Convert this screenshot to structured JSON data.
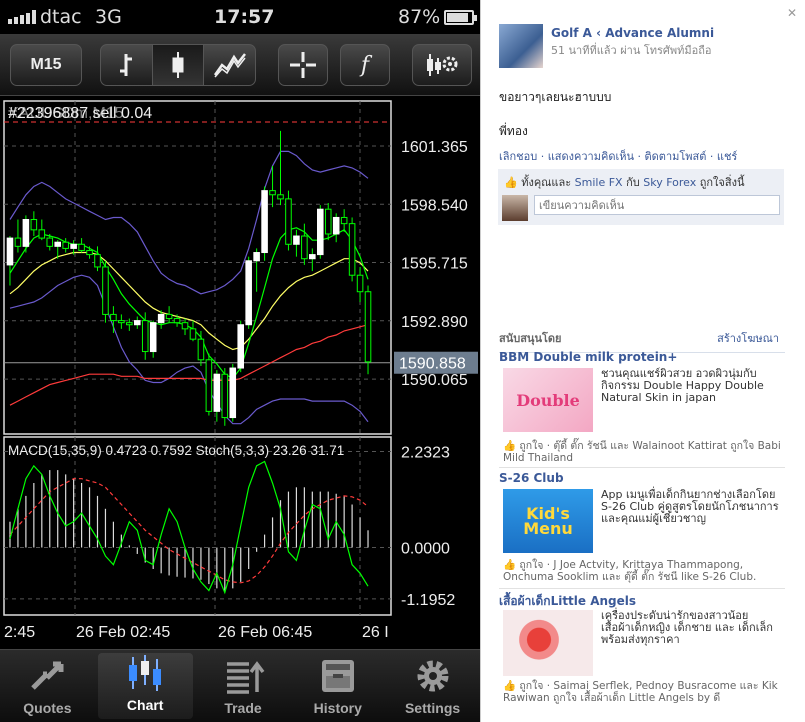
{
  "status_bar": {
    "carrier": "dtac",
    "network": "3G",
    "time": "17:57",
    "battery": "87%",
    "battery_level": 0.87
  },
  "toolbar": {
    "timeframe": "M15",
    "indicator_symbol": "f"
  },
  "chart": {
    "symbol_overlay": "#22396887 sell 0.04",
    "symbol_overlay_2": "XAUUSDm,M15",
    "price_ticks": [
      "1601.365",
      "1598.540",
      "1595.715",
      "1592.890",
      "1590.065"
    ],
    "current_price": "1590.858",
    "indicator_label": "MACD(15,35,9) 0.4723 0.7592 Stoch(5,3,3) 23.26 31.71",
    "indicator_ticks": [
      "2.2323",
      "0.0000",
      "-1.1952"
    ],
    "time_labels": [
      "2:45",
      "26 Feb 02:45",
      "26 Feb 06:45",
      "26 I"
    ],
    "colors": {
      "up": "#ffffff",
      "down": "#00ff00",
      "wick": "#00ff00",
      "ma_fast": "#00ff00",
      "ma_slow": "#ff3b3b",
      "ma_mid": "#ffff66",
      "bands": "#6a5acd",
      "grid": "#555555"
    }
  },
  "chart_data": {
    "type": "candlestick",
    "ylim": [
      1587.5,
      1603.4
    ],
    "y_ticks": [
      1601.365,
      1598.54,
      1595.715,
      1592.89,
      1590.065
    ],
    "current_price": 1590.858,
    "candles": [
      [
        1595.6,
        1597.0,
        1594.6,
        1596.9
      ],
      [
        1596.9,
        1597.8,
        1596.2,
        1596.5
      ],
      [
        1596.5,
        1598.0,
        1596.2,
        1597.8
      ],
      [
        1597.8,
        1598.2,
        1597.0,
        1597.3
      ],
      [
        1597.3,
        1597.8,
        1596.8,
        1596.9
      ],
      [
        1596.9,
        1597.1,
        1596.3,
        1596.5
      ],
      [
        1596.5,
        1596.8,
        1595.9,
        1596.7
      ],
      [
        1596.7,
        1596.9,
        1596.2,
        1596.4
      ],
      [
        1596.4,
        1596.8,
        1596.1,
        1596.6
      ],
      [
        1596.6,
        1596.9,
        1596.2,
        1596.3
      ],
      [
        1596.3,
        1596.5,
        1595.9,
        1596.1
      ],
      [
        1596.1,
        1596.5,
        1595.3,
        1595.5
      ],
      [
        1595.5,
        1595.8,
        1592.8,
        1593.2
      ],
      [
        1593.2,
        1593.6,
        1592.3,
        1592.9
      ],
      [
        1592.9,
        1593.2,
        1592.5,
        1592.8
      ],
      [
        1592.8,
        1593.0,
        1592.4,
        1592.7
      ],
      [
        1592.7,
        1593.1,
        1592.5,
        1592.9
      ],
      [
        1592.9,
        1593.3,
        1591.0,
        1591.4
      ],
      [
        1591.4,
        1592.9,
        1591.1,
        1592.8
      ],
      [
        1592.8,
        1593.4,
        1592.5,
        1593.2
      ],
      [
        1593.2,
        1593.6,
        1592.8,
        1593.0
      ],
      [
        1593.0,
        1593.2,
        1592.6,
        1592.8
      ],
      [
        1592.8,
        1593.0,
        1592.2,
        1592.5
      ],
      [
        1592.5,
        1592.9,
        1591.9,
        1592.0
      ],
      [
        1592.0,
        1592.4,
        1590.7,
        1591.0
      ],
      [
        1591.0,
        1591.3,
        1588.3,
        1588.5
      ],
      [
        1588.5,
        1590.5,
        1588.0,
        1590.3
      ],
      [
        1590.3,
        1590.6,
        1587.8,
        1588.2
      ],
      [
        1588.2,
        1590.8,
        1588.0,
        1590.6
      ],
      [
        1590.6,
        1592.9,
        1590.4,
        1592.7
      ],
      [
        1592.7,
        1596.0,
        1592.5,
        1595.8
      ],
      [
        1595.8,
        1596.4,
        1594.3,
        1596.2
      ],
      [
        1596.2,
        1599.4,
        1595.8,
        1599.2
      ],
      [
        1599.2,
        1600.4,
        1598.4,
        1599.0
      ],
      [
        1599.0,
        1602.1,
        1598.5,
        1598.8
      ],
      [
        1598.8,
        1599.2,
        1596.3,
        1596.6
      ],
      [
        1596.6,
        1597.3,
        1596.0,
        1597.0
      ],
      [
        1597.0,
        1597.6,
        1595.6,
        1595.9
      ],
      [
        1595.9,
        1596.4,
        1595.3,
        1596.1
      ],
      [
        1596.1,
        1598.5,
        1595.9,
        1598.3
      ],
      [
        1598.3,
        1598.6,
        1596.8,
        1597.1
      ],
      [
        1597.1,
        1598.1,
        1596.7,
        1597.9
      ],
      [
        1597.9,
        1598.3,
        1597.2,
        1597.6
      ],
      [
        1597.6,
        1597.9,
        1594.8,
        1595.1
      ],
      [
        1595.1,
        1595.5,
        1593.8,
        1594.3
      ],
      [
        1594.3,
        1594.6,
        1590.3,
        1590.9
      ]
    ],
    "ma_fast": [
      1595.2,
      1595.8,
      1596.4,
      1596.9,
      1597.1,
      1597.0,
      1596.9,
      1596.7,
      1596.6,
      1596.6,
      1596.4,
      1596.2,
      1595.5,
      1594.9,
      1594.2,
      1593.7,
      1593.3,
      1592.9,
      1592.8,
      1592.7,
      1592.8,
      1592.8,
      1592.7,
      1592.5,
      1592.1,
      1591.2,
      1590.8,
      1590.3,
      1590.1,
      1590.6,
      1591.8,
      1593.1,
      1594.5,
      1595.9,
      1596.9,
      1597.3,
      1597.4,
      1597.2,
      1596.8,
      1596.8,
      1596.9,
      1597.1,
      1597.3,
      1596.8,
      1596.0,
      1594.9
    ],
    "ma_mid": [
      1594.2,
      1594.5,
      1594.9,
      1595.3,
      1595.6,
      1595.8,
      1596.0,
      1596.1,
      1596.2,
      1596.2,
      1596.2,
      1596.1,
      1595.8,
      1595.4,
      1595.0,
      1594.6,
      1594.2,
      1593.8,
      1593.5,
      1593.3,
      1593.2,
      1593.1,
      1593.0,
      1592.9,
      1592.7,
      1592.3,
      1592.0,
      1591.7,
      1591.5,
      1591.6,
      1592.0,
      1592.5,
      1593.0,
      1593.6,
      1594.1,
      1594.5,
      1594.8,
      1595.0,
      1595.1,
      1595.3,
      1595.5,
      1595.7,
      1595.9,
      1595.9,
      1595.7,
      1595.3
    ],
    "ma_slow": [
      1588.8,
      1589.0,
      1589.2,
      1589.4,
      1589.6,
      1589.8,
      1589.9,
      1590.0,
      1590.1,
      1590.2,
      1590.3,
      1590.3,
      1590.3,
      1590.3,
      1590.2,
      1590.2,
      1590.2,
      1590.1,
      1590.1,
      1590.1,
      1590.1,
      1590.1,
      1590.1,
      1590.1,
      1590.1,
      1590.0,
      1590.0,
      1590.0,
      1590.0,
      1590.1,
      1590.3,
      1590.5,
      1590.7,
      1590.9,
      1591.1,
      1591.3,
      1591.5,
      1591.6,
      1591.8,
      1591.9,
      1592.1,
      1592.2,
      1592.4,
      1592.5,
      1592.6,
      1592.7
    ],
    "band_upper": [
      1597.8,
      1598.4,
      1599.0,
      1599.4,
      1599.6,
      1599.4,
      1599.1,
      1598.8,
      1598.6,
      1598.4,
      1598.2,
      1598.0,
      1597.8,
      1597.9,
      1597.9,
      1597.6,
      1597.2,
      1596.5,
      1595.8,
      1595.2,
      1594.9,
      1594.7,
      1594.6,
      1594.4,
      1594.2,
      1594.3,
      1594.4,
      1594.6,
      1594.9,
      1595.3,
      1596.4,
      1597.8,
      1599.3,
      1600.4,
      1601.1,
      1601.1,
      1600.9,
      1600.5,
      1600.2,
      1600.1,
      1600.2,
      1600.3,
      1600.4,
      1600.3,
      1600.1,
      1599.8
    ],
    "band_lower": [
      1593.5,
      1593.6,
      1593.7,
      1593.8,
      1594.0,
      1594.3,
      1594.6,
      1594.8,
      1595.0,
      1595.1,
      1595.0,
      1594.6,
      1593.6,
      1592.6,
      1591.6,
      1590.9,
      1590.5,
      1590.0,
      1589.9,
      1589.9,
      1590.1,
      1590.4,
      1590.6,
      1590.7,
      1590.4,
      1589.5,
      1588.9,
      1588.3,
      1587.9,
      1587.9,
      1588.2,
      1588.6,
      1588.8,
      1589.0,
      1589.1,
      1589.1,
      1589.1,
      1589.1,
      1589.0,
      1589.0,
      1589.0,
      1589.0,
      1589.0,
      1588.8,
      1588.5,
      1588.0
    ],
    "indicator": {
      "ylim": [
        -1.5,
        2.5
      ],
      "macd_hist": [
        0.6,
        0.9,
        1.2,
        1.5,
        1.7,
        1.8,
        1.8,
        1.7,
        1.6,
        1.5,
        1.4,
        1.2,
        0.9,
        0.6,
        0.3,
        0.05,
        -0.15,
        -0.35,
        -0.5,
        -0.6,
        -0.65,
        -0.68,
        -0.7,
        -0.72,
        -0.75,
        -0.85,
        -0.95,
        -1.0,
        -0.95,
        -0.8,
        -0.5,
        -0.1,
        0.3,
        0.7,
        1.1,
        1.3,
        1.4,
        1.4,
        1.3,
        1.3,
        1.3,
        1.25,
        1.2,
        1.0,
        0.7,
        0.4
      ],
      "signal": [
        0.3,
        0.5,
        0.7,
        0.9,
        1.1,
        1.3,
        1.4,
        1.5,
        1.6,
        1.6,
        1.55,
        1.5,
        1.4,
        1.2,
        1.0,
        0.8,
        0.6,
        0.4,
        0.25,
        0.1,
        -0.05,
        -0.15,
        -0.25,
        -0.35,
        -0.45,
        -0.55,
        -0.65,
        -0.75,
        -0.8,
        -0.82,
        -0.78,
        -0.65,
        -0.45,
        -0.2,
        0.1,
        0.35,
        0.55,
        0.75,
        0.9,
        1.0,
        1.1,
        1.15,
        1.2,
        1.18,
        1.1,
        0.95
      ],
      "stoch_k": [
        0.2,
        0.9,
        1.6,
        1.9,
        1.7,
        1.2,
        0.8,
        0.5,
        0.6,
        0.8,
        0.5,
        0.2,
        -0.2,
        -0.4,
        0.1,
        0.6,
        0.4,
        -0.3,
        -0.4,
        0.3,
        0.9,
        0.6,
        0.0,
        -0.5,
        -0.8,
        -1.0,
        -0.6,
        -1.05,
        -0.4,
        0.5,
        1.4,
        1.9,
        2.0,
        1.5,
        0.9,
        -0.1,
        -0.3,
        0.4,
        1.0,
        0.9,
        0.2,
        0.6,
        0.3,
        -0.4,
        -0.6,
        -0.9
      ]
    }
  },
  "tabs": [
    {
      "label": "Quotes"
    },
    {
      "label": "Chart"
    },
    {
      "label": "Trade"
    },
    {
      "label": "History"
    },
    {
      "label": "Settings"
    }
  ],
  "facebook": {
    "close": "✕",
    "post": {
      "author": "Golf A ‹ Advance Alumni",
      "meta": "51 นาทีที่แล้ว ผ่าน โทรศัพท์มือถือ",
      "text1": "ขอยาวๆเลยนะฮาบบบ",
      "text2": "พี่ทอง",
      "actions": "เลิกชอบ · แสดงความคิดเห็น · ติดตามโพสต์ · แชร์",
      "likes_prefix": "ทั้งคุณและ",
      "likes_name1": "Smile FX",
      "likes_mid": "กับ",
      "likes_name2": "Sky Forex",
      "likes_suffix": "ถูกใจสิ่งนี้",
      "comment_placeholder": "เขียนความคิดเห็น"
    },
    "sponsored": {
      "label": "สนับสนุนโดย",
      "create": "สร้างโฆษณา"
    },
    "ads": [
      {
        "title": "BBM Double milk protein+",
        "image_text": "Double",
        "description": "ชวนคุณแชร์ผิวสวย อวดผิวนุ่มกับกิจกรรม Double Happy Double Natural Skin in japan",
        "like_text": "ถูกใจ · ตุ๊ดี้ ตั๊ก รัชนี และ Walainoot Kattirat ถูกใจ Babi Mild Thailand"
      },
      {
        "title": "S-26 Club",
        "image_text": "Kid's Menu",
        "description": "App เมนูเพื่อเด็กกินยากช่างเลือกโดย S-26 Club คู่ดูสูตรโดยนักโภชนาการ และคุณแม่ผู้เชี่ยวชาญ",
        "like_text": "ถูกใจ · J Joe Actvity, Krittaya Thammapong, Onchuma Sooklim และ ตุ๊ดี้ ตั๊ก รัชนี like S-26 Club."
      },
      {
        "title": "เสื้อผ้าเด็กLittle Angels",
        "image_text": "",
        "description": "เครื่องประดับน่ารักของสาวน้อย เสื้อผ้าเด็กหญิง เด็กชาย และ เด็กเล็ก พร้อมส่งทุกราคา",
        "like_text": "ถูกใจ · Saimai Serflek, Pednoy Busracome และ Kik Rawiwan ถูกใจ เสื้อผ้าเด็ก Little Angels by ดี"
      }
    ]
  }
}
